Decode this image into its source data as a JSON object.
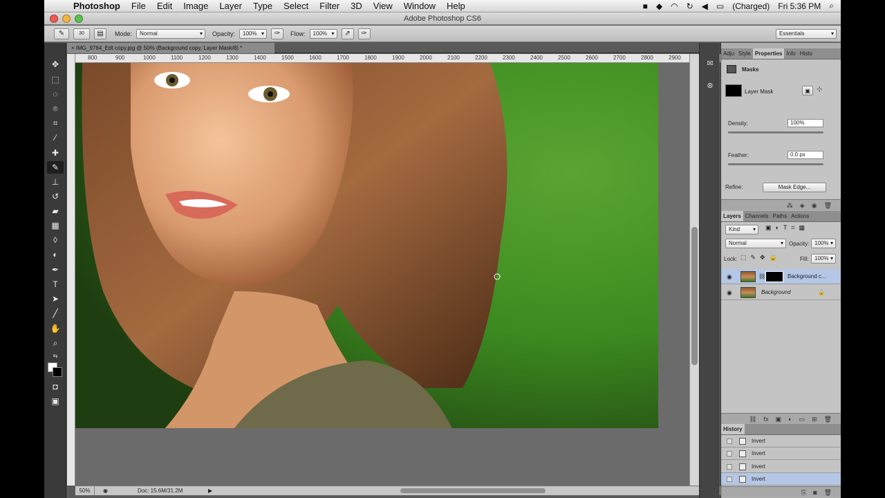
{
  "menubar": {
    "app_name": "Photoshop",
    "items": [
      "File",
      "Edit",
      "Image",
      "Layer",
      "Type",
      "Select",
      "Filter",
      "3D",
      "View",
      "Window",
      "Help"
    ],
    "battery": "(Charged)",
    "clock": "Fri 5:36 PM"
  },
  "window": {
    "title": "Adobe Photoshop CS6"
  },
  "options": {
    "brush_size": "30",
    "mode_label": "Mode:",
    "mode_value": "Normal",
    "opacity_label": "Opacity:",
    "opacity_value": "100%",
    "flow_label": "Flow:",
    "flow_value": "100%",
    "workspace": "Essentials"
  },
  "document": {
    "tab_title": "IMG_9764_Edt copy.jpg @ 50% (Background copy, Layer Mask/8) *",
    "ruler_ticks": [
      "800",
      "900",
      "1000",
      "1100",
      "1200",
      "1300",
      "1400",
      "1500",
      "1600",
      "1700",
      "1800",
      "1900",
      "2000",
      "2100",
      "2200",
      "2300",
      "2400",
      "2500",
      "2600",
      "2700",
      "2800",
      "2900"
    ],
    "zoom": "50%",
    "doc_info": "Doc: 15.6M/31.2M"
  },
  "properties": {
    "tabs": [
      "Adju",
      "Style",
      "Properties",
      "Info",
      "Histo"
    ],
    "section": "Masks",
    "mask_type": "Layer Mask",
    "density_label": "Density:",
    "density_value": "100%",
    "feather_label": "Feather:",
    "feather_value": "0.0 px",
    "refine_label": "Refine:",
    "mask_edge_button": "Mask Edge..."
  },
  "layers": {
    "tabs": [
      "Layers",
      "Channels",
      "Paths",
      "Actions"
    ],
    "kind": "Kind",
    "blend_mode": "Normal",
    "opacity_label": "Opacity:",
    "opacity_value": "100%",
    "lock_label": "Lock:",
    "fill_label": "Fill:",
    "fill_value": "100%",
    "items": [
      {
        "name": "Background c..."
      },
      {
        "name": "Background"
      }
    ]
  },
  "history": {
    "title": "History",
    "items": [
      "Invert",
      "Invert",
      "Invert",
      "Invert"
    ]
  },
  "colors": {
    "accent": "#b5c7e6",
    "canvas_bg": "#6b6b6b"
  }
}
